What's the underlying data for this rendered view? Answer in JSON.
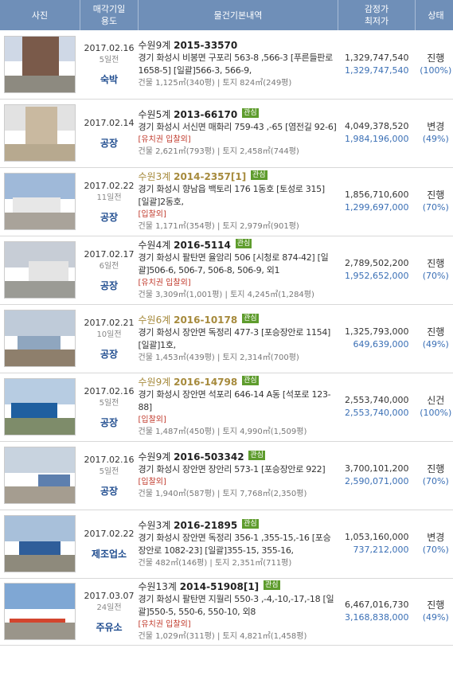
{
  "headers": {
    "photo": "사진",
    "date_line1": "매각기일",
    "date_line2": "용도",
    "info": "물건기본내역",
    "price_line1": "감정가",
    "price_line2": "최저가",
    "status": "상태"
  },
  "badge_label": "관심",
  "rows": [
    {
      "date": "2017.02.16",
      "days": "5일전",
      "use": "숙박",
      "court": "수원9계",
      "case_no": "2015-33570",
      "badge": false,
      "highlight": false,
      "addr": "경기 화성시 비봉면 구포리 563-8 ,566-3 [푸른들판로 1658-5] [일괄]566-3, 566-9,",
      "warn": "",
      "area": "건물 1,125㎡(340평) | 토지 824㎡(249평)",
      "appraisal": "1,329,747,540",
      "minimum": "1,329,747,540",
      "status": "진행",
      "pct": "(100%)"
    },
    {
      "date": "2017.02.14",
      "days": "",
      "use": "공장",
      "court": "수원5계",
      "case_no": "2013-66170",
      "badge": true,
      "highlight": false,
      "addr": "경기 화성시 서신면 매화리 759-43 ,-65 [염전길 92-6]",
      "warn": "[유치권 입찰외]",
      "area": "건물 2,621㎡(793평) | 토지 2,458㎡(744평)",
      "appraisal": "4,049,378,520",
      "minimum": "1,984,196,000",
      "status": "변경",
      "pct": "(49%)"
    },
    {
      "date": "2017.02.22",
      "days": "11일전",
      "use": "공장",
      "court": "수원3계",
      "case_no": "2014-2357[1]",
      "badge": true,
      "highlight": true,
      "addr": "경기 화성시 향남읍 백토리 176 1동호 [토성로 315] [일괄]2동호,",
      "warn": "[입찰외]",
      "area": "건물 1,171㎡(354평) | 토지 2,979㎡(901평)",
      "appraisal": "1,856,710,600",
      "minimum": "1,299,697,000",
      "status": "진행",
      "pct": "(70%)"
    },
    {
      "date": "2017.02.17",
      "days": "6일전",
      "use": "공장",
      "court": "수원4계",
      "case_no": "2016-5114",
      "badge": true,
      "highlight": false,
      "addr": "경기 화성시 팔탄면 율암리 506 [시청로 874-42] [일괄]506-6, 506-7, 506-8, 506-9, 외1",
      "warn": "[유치권 입찰외]",
      "area": "건물 3,309㎡(1,001평) | 토지 4,245㎡(1,284평)",
      "appraisal": "2,789,502,200",
      "minimum": "1,952,652,000",
      "status": "진행",
      "pct": "(70%)"
    },
    {
      "date": "2017.02.21",
      "days": "10일전",
      "use": "공장",
      "court": "수원6계",
      "case_no": "2016-10178",
      "badge": true,
      "highlight": true,
      "addr": "경기 화성시 장안면 독정리 477-3 [포승장안로 1154] [일괄]1호,",
      "warn": "",
      "area": "건물 1,453㎡(439평) | 토지 2,314㎡(700평)",
      "appraisal": "1,325,793,000",
      "minimum": "649,639,000",
      "status": "진행",
      "pct": "(49%)"
    },
    {
      "date": "2017.02.16",
      "days": "5일전",
      "use": "공장",
      "court": "수원9계",
      "case_no": "2016-14798",
      "badge": true,
      "highlight": true,
      "addr": "경기 화성시 장안면 석포리 646-14 A동 [석포로 123-88]",
      "warn": "[입찰외]",
      "area": "건물 1,487㎡(450평) | 토지 4,990㎡(1,509평)",
      "appraisal": "2,553,740,000",
      "minimum": "2,553,740,000",
      "status": "신건",
      "pct": "(100%)"
    },
    {
      "date": "2017.02.16",
      "days": "5일전",
      "use": "공장",
      "court": "수원9계",
      "case_no": "2016-503342",
      "badge": true,
      "highlight": false,
      "addr": "경기 화성시 장안면 장안리 573-1 [포승장안로 922]",
      "warn": "[입찰외]",
      "area": "건물 1,940㎡(587평) | 토지 7,768㎡(2,350평)",
      "appraisal": "3,700,101,200",
      "minimum": "2,590,071,000",
      "status": "진행",
      "pct": "(70%)"
    },
    {
      "date": "2017.02.22",
      "days": "",
      "use": "제조업소",
      "court": "수원3계",
      "case_no": "2016-21895",
      "badge": true,
      "highlight": false,
      "addr": "경기 화성시 장안면 독정리 356-1 ,355-15,-16 [포승장안로 1082-23] [일괄]355-15, 355-16,",
      "warn": "",
      "area": "건물 482㎡(146평) | 토지 2,351㎡(711평)",
      "appraisal": "1,053,160,000",
      "minimum": "737,212,000",
      "status": "변경",
      "pct": "(70%)"
    },
    {
      "date": "2017.03.07",
      "days": "24일전",
      "use": "주유소",
      "court": "수원13계",
      "case_no": "2014-51908[1]",
      "badge": true,
      "highlight": false,
      "addr": "경기 화성시 팔탄면 지월리 550-3 ,-4,-10,-17,-18 [일괄]550-5, 550-6, 550-10, 외8",
      "warn": "[유치권 입찰외]",
      "area": "건물 1,029㎡(311평) | 토지 4,821㎡(1,458평)",
      "appraisal": "6,467,016,730",
      "minimum": "3,168,838,000",
      "status": "진행",
      "pct": "(49%)"
    }
  ]
}
